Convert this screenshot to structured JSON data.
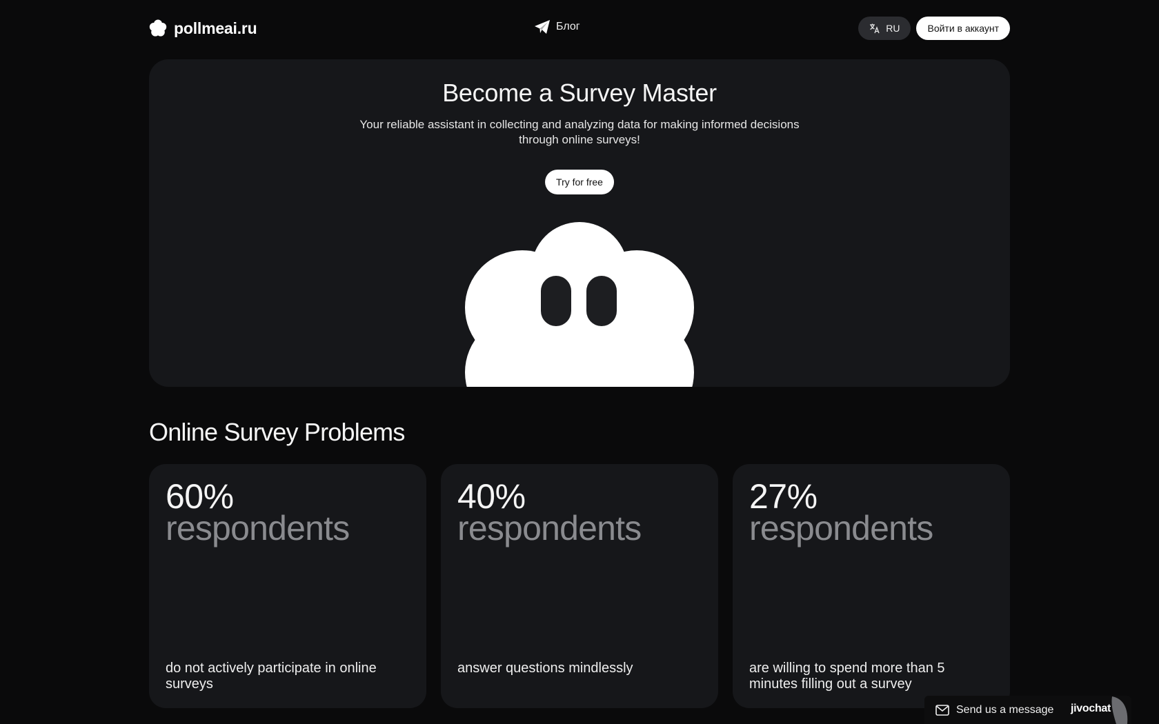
{
  "header": {
    "brand_name": "pollmeai.ru",
    "blog_label": "Блог",
    "lang_label": "RU",
    "login_label": "Войти в аккаунт"
  },
  "hero": {
    "title": "Become a Survey Master",
    "subtitle": "Your reliable assistant in collecting and analyzing data for making informed decisions through online surveys!",
    "cta_label": "Try for free"
  },
  "problems": {
    "title": "Online Survey Problems",
    "cards": [
      {
        "percent": "60%",
        "unit": "respondents",
        "description": "do not actively participate in online surveys"
      },
      {
        "percent": "40%",
        "unit": "respondents",
        "description": "answer questions mindlessly"
      },
      {
        "percent": "27%",
        "unit": "respondents",
        "description": "are willing to spend more than 5 minutes filling out a survey"
      }
    ]
  },
  "chat": {
    "label": "Send us a message",
    "brand": "jivochat"
  },
  "icons": {
    "logo": "flower-logo-icon",
    "blog": "telegram-plane-icon",
    "lang": "translate-icon",
    "chat": "mail-icon"
  },
  "colors": {
    "background": "#0a0a0b",
    "card": "#16171a",
    "muted_text": "#8a8b8f",
    "button_light": "#ffffff"
  }
}
